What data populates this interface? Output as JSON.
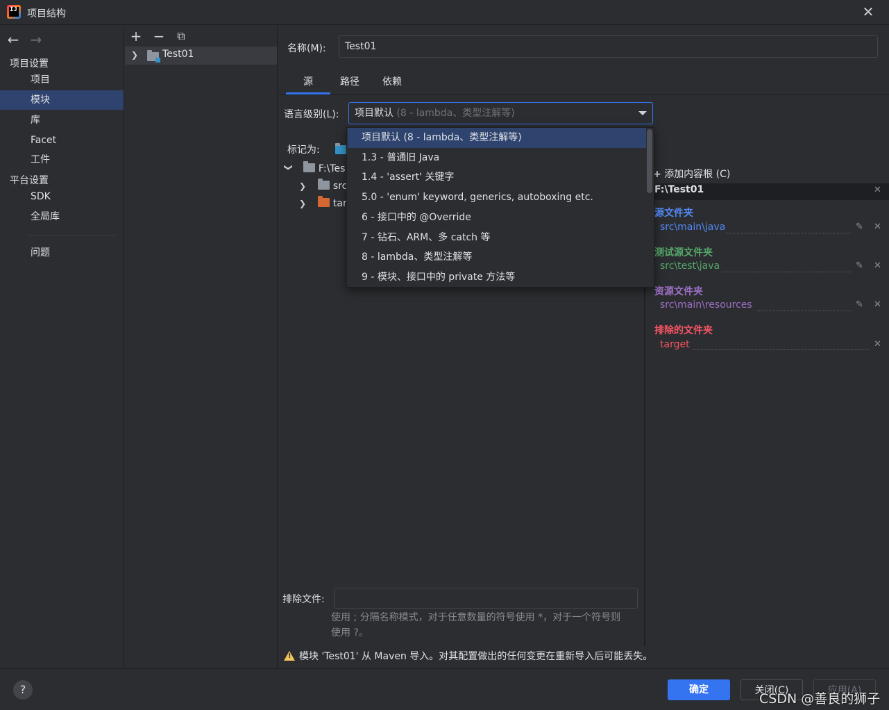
{
  "window": {
    "title": "项目结构"
  },
  "nav": {
    "project_settings_heading": "项目设置",
    "project_items": [
      "项目",
      "模块",
      "库",
      "Facet",
      "工件"
    ],
    "platform_settings_heading": "平台设置",
    "platform_items": [
      "SDK",
      "全局库"
    ],
    "problems": "问题",
    "selected": "模块"
  },
  "modules": {
    "items": [
      "Test01"
    ]
  },
  "main": {
    "name_label": "名称(M):",
    "name_value": "Test01",
    "tabs": [
      "源",
      "路径",
      "依赖"
    ],
    "active_tab": "源",
    "lang_label": "语言级别(L):",
    "lang_selected": "项目默认",
    "lang_selected_hint": " (8 - lambda、类型注解等)",
    "mark_as_label": "标记为:",
    "tree": {
      "root": "F:\\Tes",
      "children": [
        "src",
        "tar"
      ]
    },
    "exclude_label": "排除文件:",
    "exclude_value": "",
    "hint_line1": "使用 ; 分隔名称模式，对于任意数量的符号使用 *，对于一个符号则",
    "hint_line2": "使用 ?。",
    "warning": "模块 'Test01' 从 Maven 导入。对其配置做出的任何变更在重新导入后可能丢失。"
  },
  "dropdown": {
    "options": [
      "项目默认 (8 - lambda、类型注解等)",
      "1.3 - 普通旧 Java",
      "1.4 - 'assert' 关键字",
      "5.0 - 'enum' keyword, generics, autoboxing etc.",
      "6 - 接口中的 @Override",
      "7 - 钻石、ARM、多 catch 等",
      "8 - lambda、类型注解等",
      "9 - 模块、接口中的 private 方法等"
    ],
    "selected_index": 0
  },
  "roots": {
    "add_label": "添加内容根 (C)",
    "root_path": "F:\\Test01",
    "sources_title": "源文件夹",
    "sources_path": "src\\main\\java",
    "tests_title": "测试源文件夹",
    "tests_path": "src\\test\\java",
    "resources_title": "资源文件夹",
    "resources_path": "src\\main\\resources",
    "excluded_title": "排除的文件夹",
    "excluded_path": "target",
    "colors": {
      "sources": "#548af7",
      "tests": "#55a76a",
      "resources": "#9d70c7",
      "excluded": "#f75464"
    }
  },
  "footer": {
    "help": "?",
    "ok": "确定",
    "cancel": "关闭(C)",
    "apply": "应用(A)",
    "watermark": "CSDN @善良的狮子"
  }
}
